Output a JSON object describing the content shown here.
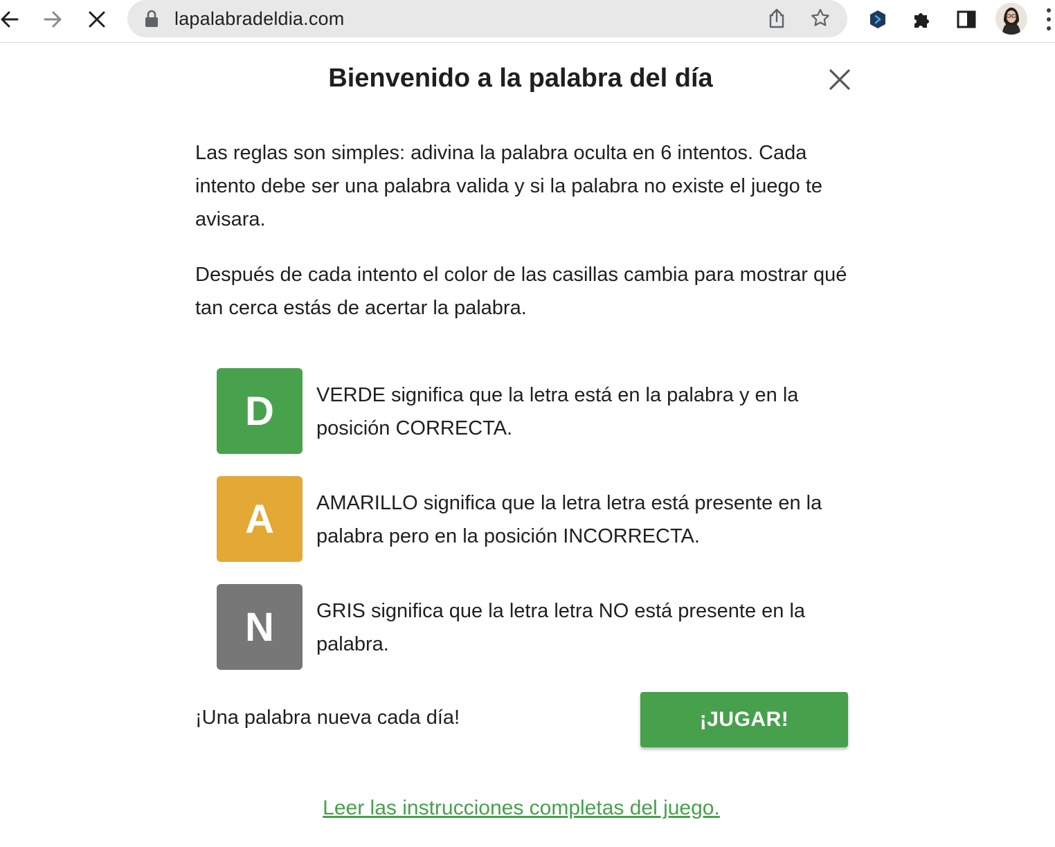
{
  "browser": {
    "url": "lapalabradeldia.com",
    "icons": {
      "back": "back-arrow-icon",
      "forward": "forward-arrow-icon",
      "stop": "close-icon",
      "lock": "lock-icon",
      "share": "share-icon",
      "bookmark": "star-icon",
      "extension1": "hexagon-extension-icon",
      "extension2": "puzzle-icon",
      "sidepanel": "side-panel-icon",
      "profile": "avatar",
      "menu": "kebab-menu-icon"
    }
  },
  "modal": {
    "title": "Bienvenido a la palabra del día",
    "paragraph1": "Las reglas son simples: adivina la palabra oculta en 6 intentos. Cada intento debe ser una palabra valida y si la palabra no existe el juego te avisara.",
    "paragraph2": "Después de cada intento el color de las casillas cambia para mostrar qué tan cerca estás de acertar la palabra.",
    "examples": [
      {
        "letter": "D",
        "color": "#48a24d",
        "description": "VERDE significa que la letra está en la palabra y en la posición CORRECTA."
      },
      {
        "letter": "A",
        "color": "#e4a834",
        "description": "AMARILLO significa que la letra letra está presente en la palabra pero en la posición INCORRECTA."
      },
      {
        "letter": "N",
        "color": "#777777",
        "description": "GRIS significa que la letra letra NO está presente en la palabra."
      }
    ],
    "daily_text": "¡Una palabra nueva cada día!",
    "play_button": "¡JUGAR!",
    "instructions_link": "Leer las instrucciones completas del juego."
  },
  "colors": {
    "accent_green": "#47a04c",
    "present_yellow": "#e4a834",
    "absent_gray": "#777777"
  }
}
